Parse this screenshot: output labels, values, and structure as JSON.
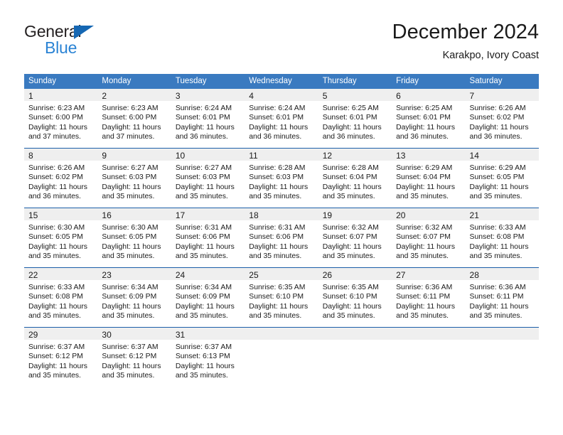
{
  "brand": {
    "name_top": "General",
    "name_bottom": "Blue",
    "triangle_color": "#1567b3",
    "bottom_color": "#2a83d4"
  },
  "header": {
    "title": "December 2024",
    "subtitle": "Karakpo, Ivory Coast"
  },
  "theme": {
    "header_bg": "#3a7ac0",
    "header_text": "#ffffff",
    "row_divider": "#1b5ea8",
    "daynum_band": "#efefef",
    "body_text": "#1a1a1a"
  },
  "weekday_headers": [
    "Sunday",
    "Monday",
    "Tuesday",
    "Wednesday",
    "Thursday",
    "Friday",
    "Saturday"
  ],
  "weeks": [
    [
      {
        "day": "1",
        "lines": [
          "Sunrise: 6:23 AM",
          "Sunset: 6:00 PM",
          "Daylight: 11 hours",
          "and 37 minutes."
        ]
      },
      {
        "day": "2",
        "lines": [
          "Sunrise: 6:23 AM",
          "Sunset: 6:00 PM",
          "Daylight: 11 hours",
          "and 37 minutes."
        ]
      },
      {
        "day": "3",
        "lines": [
          "Sunrise: 6:24 AM",
          "Sunset: 6:01 PM",
          "Daylight: 11 hours",
          "and 36 minutes."
        ]
      },
      {
        "day": "4",
        "lines": [
          "Sunrise: 6:24 AM",
          "Sunset: 6:01 PM",
          "Daylight: 11 hours",
          "and 36 minutes."
        ]
      },
      {
        "day": "5",
        "lines": [
          "Sunrise: 6:25 AM",
          "Sunset: 6:01 PM",
          "Daylight: 11 hours",
          "and 36 minutes."
        ]
      },
      {
        "day": "6",
        "lines": [
          "Sunrise: 6:25 AM",
          "Sunset: 6:01 PM",
          "Daylight: 11 hours",
          "and 36 minutes."
        ]
      },
      {
        "day": "7",
        "lines": [
          "Sunrise: 6:26 AM",
          "Sunset: 6:02 PM",
          "Daylight: 11 hours",
          "and 36 minutes."
        ]
      }
    ],
    [
      {
        "day": "8",
        "lines": [
          "Sunrise: 6:26 AM",
          "Sunset: 6:02 PM",
          "Daylight: 11 hours",
          "and 36 minutes."
        ]
      },
      {
        "day": "9",
        "lines": [
          "Sunrise: 6:27 AM",
          "Sunset: 6:03 PM",
          "Daylight: 11 hours",
          "and 35 minutes."
        ]
      },
      {
        "day": "10",
        "lines": [
          "Sunrise: 6:27 AM",
          "Sunset: 6:03 PM",
          "Daylight: 11 hours",
          "and 35 minutes."
        ]
      },
      {
        "day": "11",
        "lines": [
          "Sunrise: 6:28 AM",
          "Sunset: 6:03 PM",
          "Daylight: 11 hours",
          "and 35 minutes."
        ]
      },
      {
        "day": "12",
        "lines": [
          "Sunrise: 6:28 AM",
          "Sunset: 6:04 PM",
          "Daylight: 11 hours",
          "and 35 minutes."
        ]
      },
      {
        "day": "13",
        "lines": [
          "Sunrise: 6:29 AM",
          "Sunset: 6:04 PM",
          "Daylight: 11 hours",
          "and 35 minutes."
        ]
      },
      {
        "day": "14",
        "lines": [
          "Sunrise: 6:29 AM",
          "Sunset: 6:05 PM",
          "Daylight: 11 hours",
          "and 35 minutes."
        ]
      }
    ],
    [
      {
        "day": "15",
        "lines": [
          "Sunrise: 6:30 AM",
          "Sunset: 6:05 PM",
          "Daylight: 11 hours",
          "and 35 minutes."
        ]
      },
      {
        "day": "16",
        "lines": [
          "Sunrise: 6:30 AM",
          "Sunset: 6:05 PM",
          "Daylight: 11 hours",
          "and 35 minutes."
        ]
      },
      {
        "day": "17",
        "lines": [
          "Sunrise: 6:31 AM",
          "Sunset: 6:06 PM",
          "Daylight: 11 hours",
          "and 35 minutes."
        ]
      },
      {
        "day": "18",
        "lines": [
          "Sunrise: 6:31 AM",
          "Sunset: 6:06 PM",
          "Daylight: 11 hours",
          "and 35 minutes."
        ]
      },
      {
        "day": "19",
        "lines": [
          "Sunrise: 6:32 AM",
          "Sunset: 6:07 PM",
          "Daylight: 11 hours",
          "and 35 minutes."
        ]
      },
      {
        "day": "20",
        "lines": [
          "Sunrise: 6:32 AM",
          "Sunset: 6:07 PM",
          "Daylight: 11 hours",
          "and 35 minutes."
        ]
      },
      {
        "day": "21",
        "lines": [
          "Sunrise: 6:33 AM",
          "Sunset: 6:08 PM",
          "Daylight: 11 hours",
          "and 35 minutes."
        ]
      }
    ],
    [
      {
        "day": "22",
        "lines": [
          "Sunrise: 6:33 AM",
          "Sunset: 6:08 PM",
          "Daylight: 11 hours",
          "and 35 minutes."
        ]
      },
      {
        "day": "23",
        "lines": [
          "Sunrise: 6:34 AM",
          "Sunset: 6:09 PM",
          "Daylight: 11 hours",
          "and 35 minutes."
        ]
      },
      {
        "day": "24",
        "lines": [
          "Sunrise: 6:34 AM",
          "Sunset: 6:09 PM",
          "Daylight: 11 hours",
          "and 35 minutes."
        ]
      },
      {
        "day": "25",
        "lines": [
          "Sunrise: 6:35 AM",
          "Sunset: 6:10 PM",
          "Daylight: 11 hours",
          "and 35 minutes."
        ]
      },
      {
        "day": "26",
        "lines": [
          "Sunrise: 6:35 AM",
          "Sunset: 6:10 PM",
          "Daylight: 11 hours",
          "and 35 minutes."
        ]
      },
      {
        "day": "27",
        "lines": [
          "Sunrise: 6:36 AM",
          "Sunset: 6:11 PM",
          "Daylight: 11 hours",
          "and 35 minutes."
        ]
      },
      {
        "day": "28",
        "lines": [
          "Sunrise: 6:36 AM",
          "Sunset: 6:11 PM",
          "Daylight: 11 hours",
          "and 35 minutes."
        ]
      }
    ],
    [
      {
        "day": "29",
        "lines": [
          "Sunrise: 6:37 AM",
          "Sunset: 6:12 PM",
          "Daylight: 11 hours",
          "and 35 minutes."
        ]
      },
      {
        "day": "30",
        "lines": [
          "Sunrise: 6:37 AM",
          "Sunset: 6:12 PM",
          "Daylight: 11 hours",
          "and 35 minutes."
        ]
      },
      {
        "day": "31",
        "lines": [
          "Sunrise: 6:37 AM",
          "Sunset: 6:13 PM",
          "Daylight: 11 hours",
          "and 35 minutes."
        ]
      },
      {
        "day": "",
        "lines": []
      },
      {
        "day": "",
        "lines": []
      },
      {
        "day": "",
        "lines": []
      },
      {
        "day": "",
        "lines": []
      }
    ]
  ]
}
